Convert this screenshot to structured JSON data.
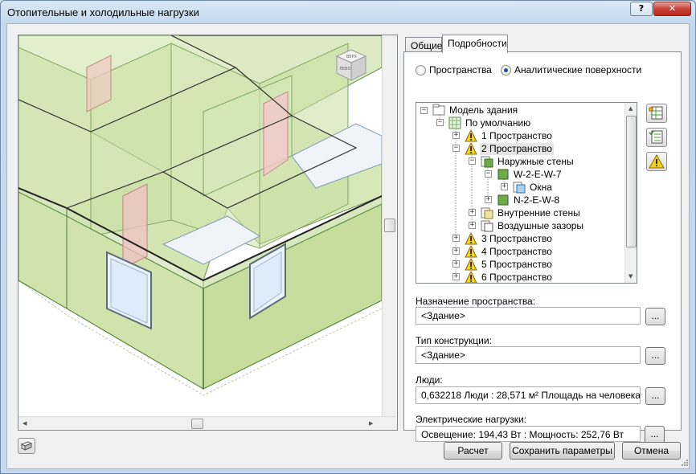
{
  "window": {
    "title": "Отопительные и холодильные нагрузки",
    "help_label": "?",
    "close_label": "✕"
  },
  "viewcube": {
    "top_label": "ВЕРХ",
    "side_label": "ЛЕВО"
  },
  "tabs": [
    {
      "label": "Общие"
    },
    {
      "label": "Подробности"
    }
  ],
  "radio": {
    "spaces": "Пространства",
    "surfaces": "Аналитические поверхности",
    "selected": "surfaces"
  },
  "tree": {
    "items": [
      {
        "label": "Модель здания"
      },
      {
        "label": "По умолчанию"
      },
      {
        "label": "1 Пространство"
      },
      {
        "label": "2 Пространство"
      },
      {
        "label": "Наружные стены"
      },
      {
        "label": "W-2-E-W-7"
      },
      {
        "label": "Окна"
      },
      {
        "label": "N-2-E-W-8"
      },
      {
        "label": "Внутренние стены"
      },
      {
        "label": "Воздушные зазоры"
      },
      {
        "label": "3 Пространство"
      },
      {
        "label": "4 Пространство"
      },
      {
        "label": "5 Пространство"
      },
      {
        "label": "6 Пространство"
      }
    ],
    "selected": "2 Пространство"
  },
  "fields": {
    "purpose_label": "Назначение пространства:",
    "purpose_value": "<Здание>",
    "construction_label": "Тип конструкции:",
    "construction_value": "<Здание>",
    "people_label": "Люди:",
    "people_value": "0,632218 Люди :  28,571 м² Площадь на человека",
    "electrical_label": "Электрические нагрузки:",
    "electrical_value": "Освещение: 194,43 Вт : Мощность: 252,76 Вт",
    "browse_label": "..."
  },
  "buttons": {
    "calculate": "Расчет",
    "save": "Сохранить параметры",
    "cancel": "Отмена"
  },
  "colors": {
    "wall_fill": "#d3e6b2",
    "wall_stroke": "#7fa860",
    "warning": "#f5d020",
    "selection": "#e5e5e5"
  }
}
